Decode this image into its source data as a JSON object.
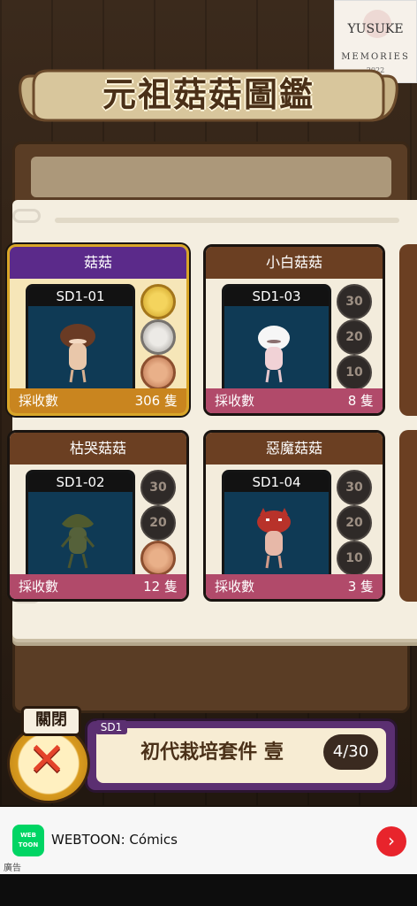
{
  "watermark": {
    "top": "YUSUKE",
    "middle": "MEMORIES",
    "bottom": "2022"
  },
  "title": "元祖菇菇圖鑑",
  "colors": {
    "gold_head": "#5b2a8a",
    "brown_head": "#6b3f22",
    "foot_pink": "#b14a6a",
    "foot_gold": "#c9851f",
    "panel": "#0f3a55"
  },
  "cards": [
    {
      "name": "菇菇",
      "code": "SD1-01",
      "count_label": "採收數",
      "count": "306 隻",
      "medals": [
        {
          "type": "gold",
          "text": ""
        },
        {
          "type": "silver",
          "text": ""
        },
        {
          "type": "bronze",
          "text": ""
        }
      ],
      "icon": "brown-mushroom-icon"
    },
    {
      "name": "小白菇菇",
      "code": "SD1-03",
      "count_label": "採收數",
      "count": "8 隻",
      "medals": [
        {
          "type": "locked",
          "text": "30"
        },
        {
          "type": "locked",
          "text": "20"
        },
        {
          "type": "locked",
          "text": "10"
        }
      ],
      "icon": "white-mushroom-icon"
    },
    {
      "name": "枯哭菇菇",
      "code": "SD1-02",
      "count_label": "採收數",
      "count": "12 隻",
      "medals": [
        {
          "type": "locked",
          "text": "30"
        },
        {
          "type": "locked",
          "text": "20"
        },
        {
          "type": "bronze",
          "text": ""
        }
      ],
      "icon": "green-mushroom-icon"
    },
    {
      "name": "惡魔菇菇",
      "code": "SD1-04",
      "count_label": "採收數",
      "count": "3 隻",
      "medals": [
        {
          "type": "locked",
          "text": "30"
        },
        {
          "type": "locked",
          "text": "20"
        },
        {
          "type": "locked",
          "text": "10"
        }
      ],
      "icon": "devil-mushroom-icon"
    }
  ],
  "close": {
    "label": "關閉"
  },
  "set": {
    "tag": "SD1",
    "name": "初代栽培套件 壹",
    "progress": "4/30"
  },
  "ad": {
    "title": "WEBTOON: Cómics",
    "logo": "WEB TOON",
    "label": "廣告"
  }
}
